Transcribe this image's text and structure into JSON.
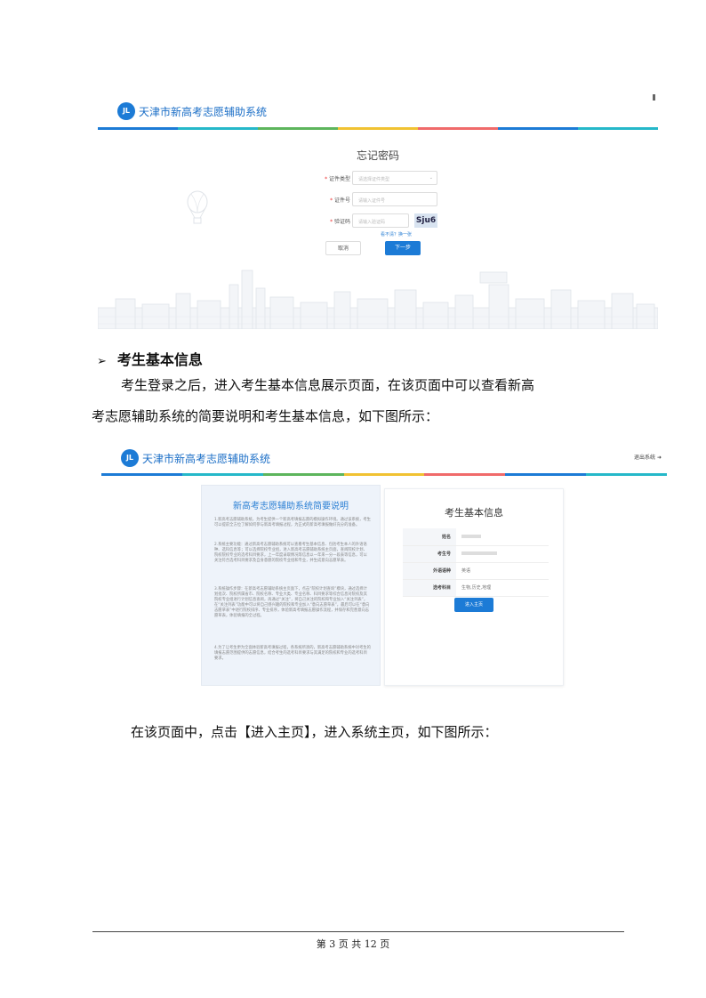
{
  "app": {
    "logo_text": "JL",
    "title": "天津市新高考志愿辅助系统",
    "stripe_colors": [
      "#1c7bd6",
      "#25b8c9",
      "#5db55c",
      "#f1c232",
      "#f06a6a",
      "#1c7bd6",
      "#25b8c9"
    ]
  },
  "forgot_password": {
    "title": "忘记密码",
    "fields": [
      {
        "label": "证件类型",
        "placeholder": "请选择证件类型"
      },
      {
        "label": "证件号",
        "placeholder": "请输入证件号"
      },
      {
        "label": "验证码",
        "placeholder": "请输入验证码"
      }
    ],
    "captcha": "Sju6",
    "refresh_text": "看不清？换一张",
    "cancel_label": "取消",
    "next_label": "下一步"
  },
  "section": {
    "heading": "考生基本信息",
    "paragraph_line1": "考生登录之后，进入考生基本信息展示页面，在该页面中可以查看新高",
    "paragraph_line2": "考志愿辅助系统的简要说明和考生基本信息，如下图所示："
  },
  "student_page": {
    "logout_label": "退出系统",
    "intro_title": "新高考志愿辅助系统简要说明",
    "intro_paragraphs": [
      "1.新高考志愿辅助系统，为考生提供一个新高考填报志愿的模拟操作环境。通过该系统，考生可以提前全方位了解如何参与新高考填报过程，为正式的新高考填报做好充分的准备。",
      "2.系统主要功能：通过新高考志愿辅助系统可以查看考生基本信息、包括考生本人的外语语种、选科信息等；可以选择院校专业组，进入新高考志愿辅助系统主页面，查阅院校计划、院校院校专业的选考科目要求，上一年度录取情况等信息以一年来一分一段表等信息，可以关注符合选考科目要求及自身意愿的院校专业组和专业，并生成意向志愿草表。",
      "3.系统操作步骤：在新高考志愿辅助系统主页面下，点击“院校计划查询”模块，通过选择计划批次、院校所属省市、院校名称、专业大类、专业名称、科目要求等综合信息对院校及其院校专业组进行计划信息查阅，再通过“关注”，将自己关注的院校和专业加入“关注列表”，在“关注列表”功能中可以将自己感兴趣的院校和专业加入“意向志愿草表”，最后可以在“意向志愿草表”中进行院校排序、专业排序，体验新高考填报志愿操作流程，并保存和完善意向志愿草表，体验填报的全过程。",
      "4.为了让考生更为全面体验新高考填报过程，各系统所须的，新高考志愿辅助系统中对考生的填报志愿范围提供的志愿信息，结合考生的选考科目要求与其满足的院校和专业的选考科目要求。"
    ],
    "info_title": "考生基本信息",
    "info_rows": [
      {
        "label": "姓名",
        "value": ""
      },
      {
        "label": "考生号",
        "value": ""
      },
      {
        "label": "外语语种",
        "value": "英语"
      },
      {
        "label": "选考科目",
        "value": "生物,历史,地理"
      }
    ],
    "enter_label": "进入主页"
  },
  "closing_paragraph": "在该页面中，点击【进入主页】，进入系统主页，如下图所示：",
  "footer": {
    "text": "第 3 页 共 12 页"
  }
}
